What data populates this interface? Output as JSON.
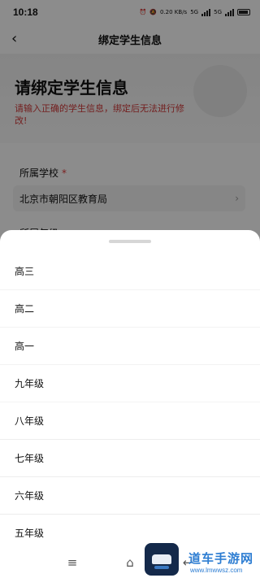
{
  "status_bar": {
    "time": "10:18",
    "net_speed": "0.20 KB/s",
    "network_1": "5G",
    "network_2": "5G"
  },
  "nav": {
    "back_glyph": "‹",
    "title": "绑定学生信息"
  },
  "hero": {
    "title": "请绑定学生信息",
    "warning": "请输入正确的学生信息，绑定后无法进行修改!"
  },
  "form": {
    "school_label": "所属学校",
    "required_mark": "*",
    "school_value": "北京市朝阳区教育局",
    "grade_label": "所属年级"
  },
  "sheet": {
    "options": [
      "高三",
      "高二",
      "高一",
      "九年级",
      "八年级",
      "七年级",
      "六年级",
      "五年级"
    ]
  },
  "sys_nav": {
    "menu_glyph": "≡",
    "home_glyph": "⌂",
    "back_glyph": "↩"
  },
  "watermark": {
    "text": "道车手游网",
    "url": "www.lmwwsz.com"
  },
  "colors": {
    "warning_red": "#d23a3a",
    "overlay": "rgba(0,0,0,0.45)",
    "watermark_blue": "#2d7dd2"
  }
}
